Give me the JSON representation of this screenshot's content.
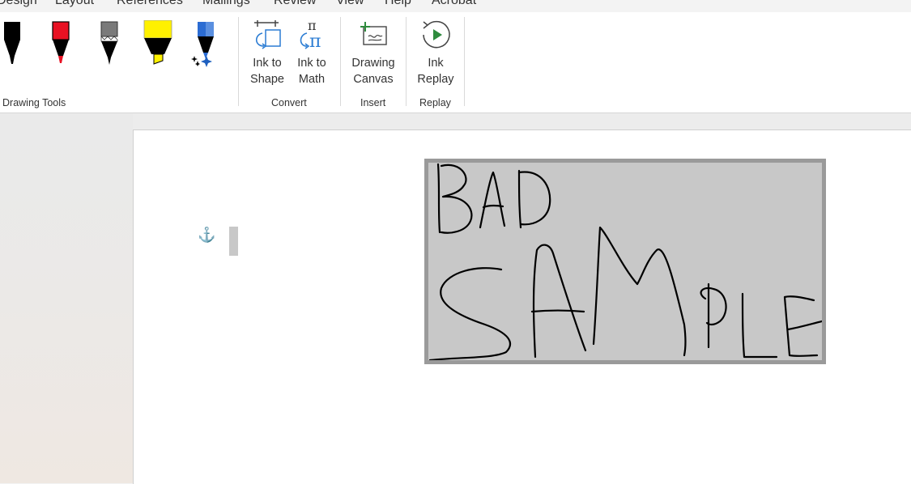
{
  "tabs": [
    "Design",
    "Layout",
    "References",
    "Mailings",
    "Review",
    "View",
    "Help",
    "Acrobat"
  ],
  "ribbon": {
    "groups": {
      "drawing_tools": "Drawing Tools",
      "convert": "Convert",
      "insert": "Insert",
      "replay": "Replay"
    },
    "buttons": {
      "ink_to_shape": [
        "Ink to",
        "Shape"
      ],
      "ink_to_math": [
        "Ink to",
        "Math"
      ],
      "drawing_canvas": [
        "Drawing",
        "Canvas"
      ],
      "ink_replay": [
        "Ink",
        "Replay"
      ]
    },
    "pens": [
      {
        "name": "black-pen",
        "color": "#000000"
      },
      {
        "name": "red-pen",
        "color": "#e81123"
      },
      {
        "name": "gray-pencil",
        "color": "#7a7a7a"
      },
      {
        "name": "yellow-highlighter",
        "color": "#fff100"
      },
      {
        "name": "galaxy-pen",
        "color": "#2b6cd3"
      }
    ]
  },
  "document": {
    "canvas_ink_text": "BAD SAMPLE"
  }
}
